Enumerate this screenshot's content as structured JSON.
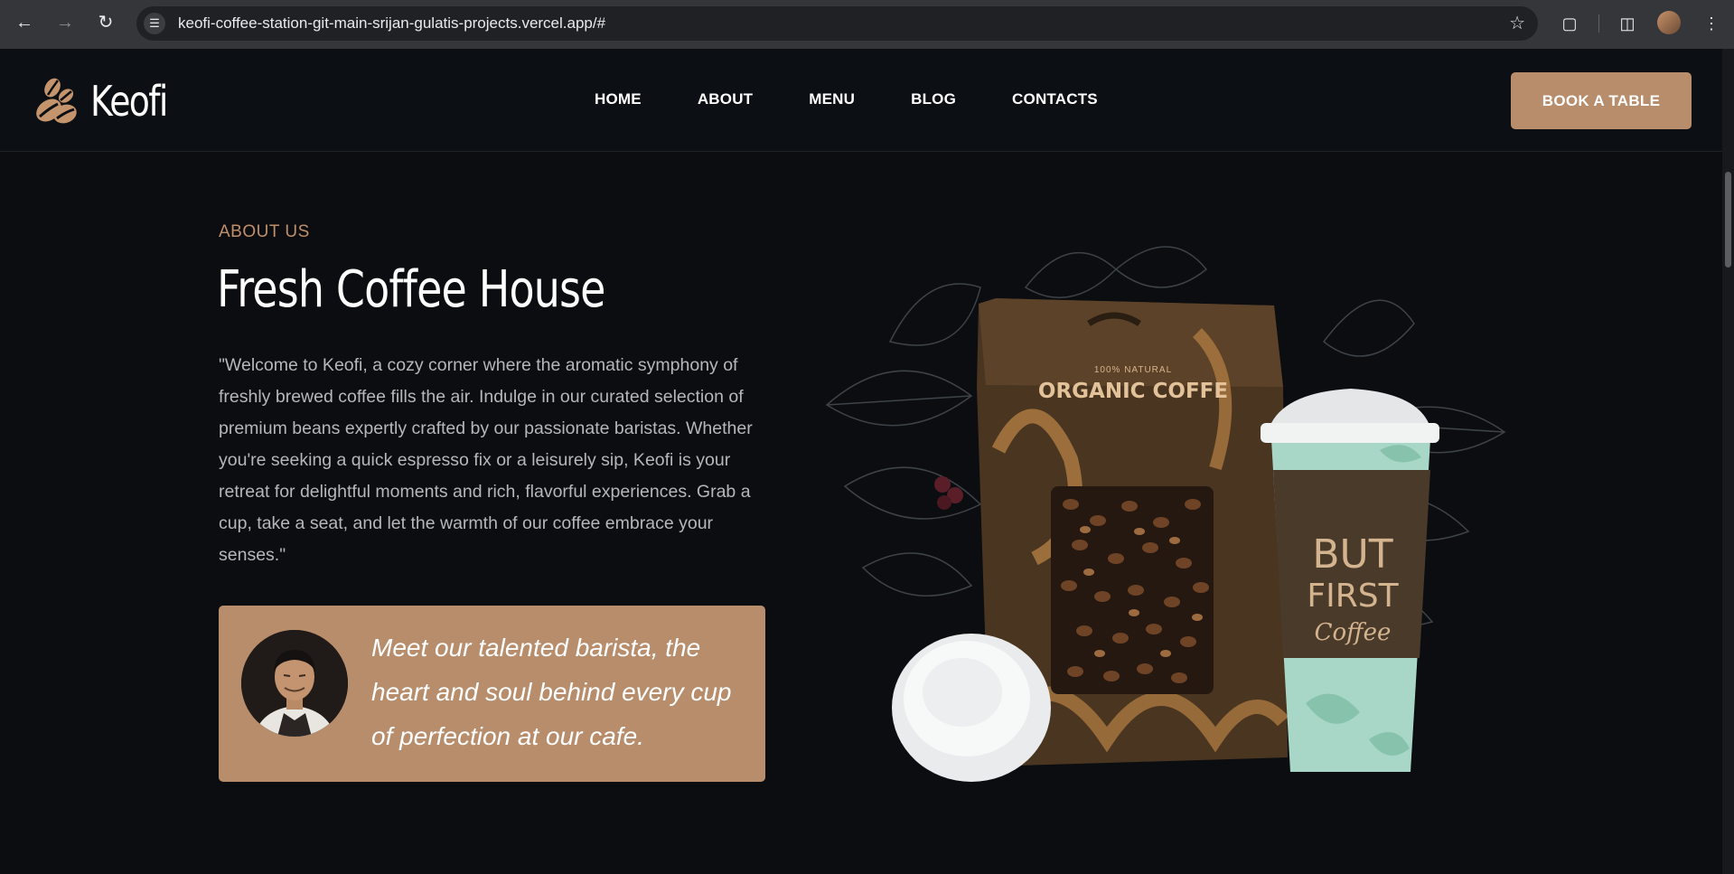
{
  "browser": {
    "url": "keofi-coffee-station-git-main-srijan-gulatis-projects.vercel.app/#",
    "icons": [
      "back-arrow-icon",
      "forward-arrow-icon",
      "reload-icon",
      "site-info-icon",
      "bookmark-star-icon",
      "extensions-icon",
      "side-panel-icon",
      "profile-avatar",
      "more-menu-icon"
    ]
  },
  "header": {
    "logo_text": "Keofi",
    "nav": [
      {
        "label": "HOME"
      },
      {
        "label": "ABOUT"
      },
      {
        "label": "MENU"
      },
      {
        "label": "BLOG"
      },
      {
        "label": "CONTACTS"
      }
    ],
    "cta_label": "BOOK A TABLE"
  },
  "about": {
    "eyebrow": "ABOUT US",
    "title": "Fresh Coffee House",
    "body": "\"Welcome to Keofi, a cozy corner where the aromatic symphony of freshly brewed coffee fills the air. Indulge in our curated selection of premium beans expertly crafted by our passionate baristas. Whether you're seeking a quick espresso fix or a leisurely sip, Keofi is your retreat for delightful moments and rich, flavorful experiences. Grab a cup, take a seat, and let the warmth of our coffee embrace your senses.\"",
    "barista_quote": "Meet our talented barista, the heart and soul behind every cup of perfection at our cafe."
  },
  "product_image": {
    "bag_small_label": "100% NATURAL",
    "bag_label": "ORGANIC COFFE",
    "cup_text_1": "BUT",
    "cup_text_2": "FIRST",
    "cup_text_3": "Coffee"
  },
  "colors": {
    "accent": "#b78d6c",
    "eyebrow": "#c08f6b",
    "background": "#0b0d10",
    "header_bg": "#0c0f13",
    "body_text": "#b4b7bc"
  }
}
